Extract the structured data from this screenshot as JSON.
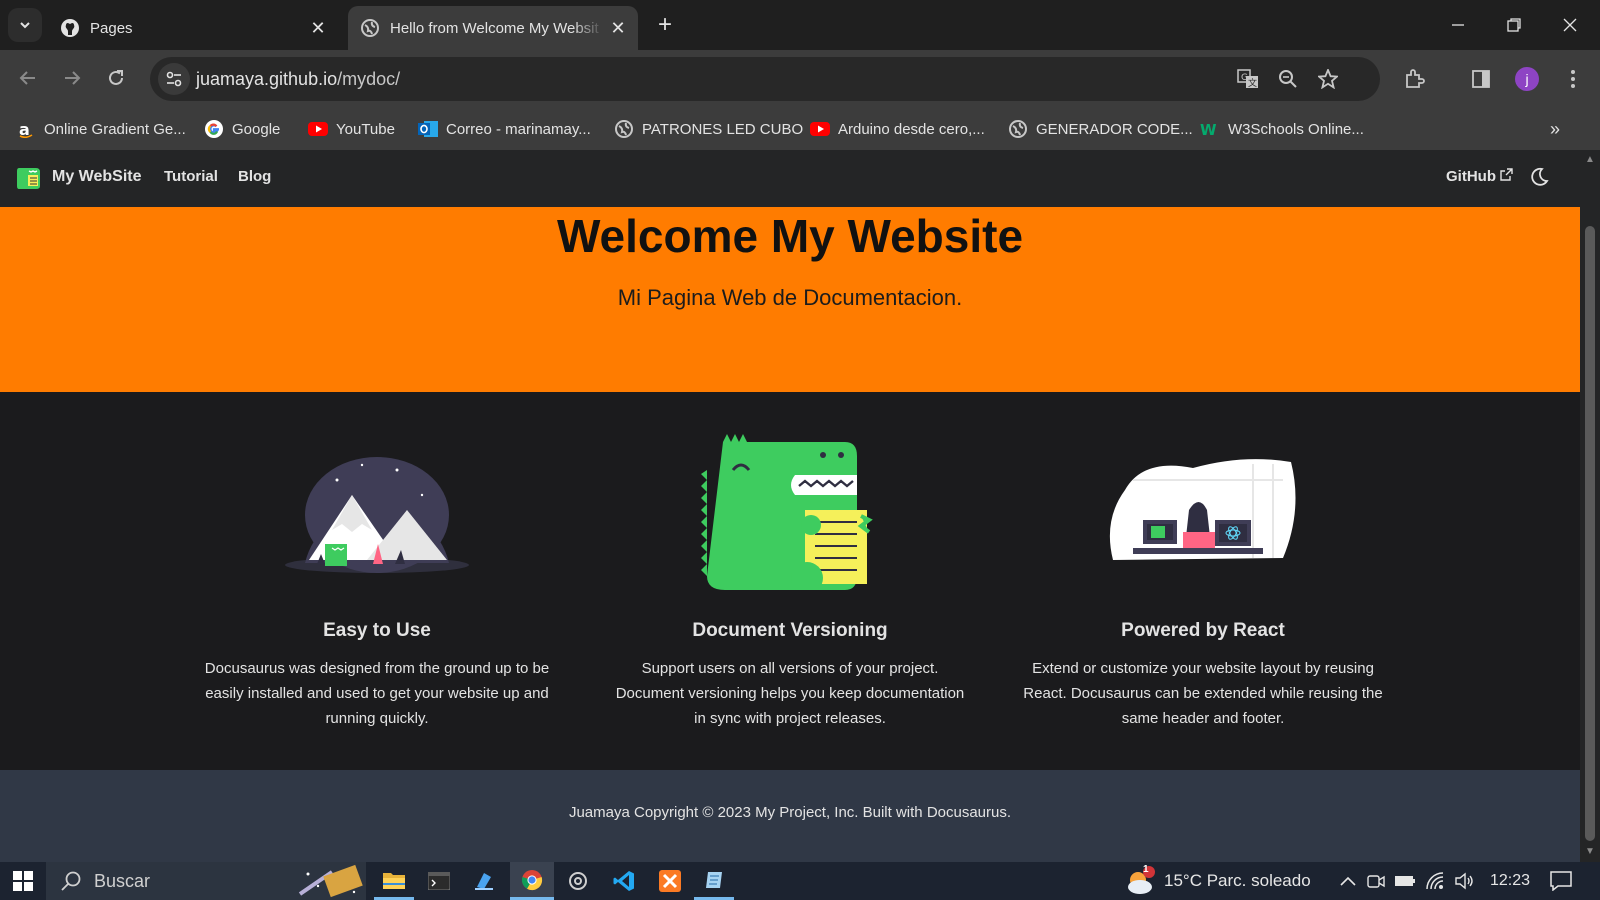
{
  "browser": {
    "tabs": [
      {
        "title": "Pages",
        "icon": "github-icon",
        "active": false
      },
      {
        "title": "Hello from Welcome My Websit",
        "icon": "globe-icon",
        "active": true
      }
    ],
    "url_host": "juamaya.github.io",
    "url_path": "/mydoc/",
    "profile_initial": "j",
    "bookmarks": [
      {
        "label": "Online Gradient Ge...",
        "icon": "a-logo-icon"
      },
      {
        "label": "Google",
        "icon": "google-icon"
      },
      {
        "label": "YouTube",
        "icon": "youtube-icon"
      },
      {
        "label": "Correo - marinamay...",
        "icon": "outlook-icon"
      },
      {
        "label": "PATRONES LED CUBO",
        "icon": "globe-icon"
      },
      {
        "label": "Arduino desde cero,...",
        "icon": "youtube-icon"
      },
      {
        "label": "GENERADOR CODE...",
        "icon": "globe-icon"
      },
      {
        "label": "W3Schools Online...",
        "icon": "w3schools-icon"
      }
    ]
  },
  "site": {
    "brand": "My WebSite",
    "nav": [
      "Tutorial",
      "Blog"
    ],
    "github": "GitHub",
    "hero_title": "Welcome My Website",
    "hero_subtitle": "Mi Pagina Web de Documentacion.",
    "features": [
      {
        "title": "Easy to Use",
        "text": "Docusaurus was designed from the ground up to be easily installed and used to get your website up and running quickly."
      },
      {
        "title": "Document Versioning",
        "text": "Support users on all versions of your project. Document versioning helps you keep documentation in sync with project releases."
      },
      {
        "title": "Powered by React",
        "text": "Extend or customize your website layout by reusing React. Docusaurus can be extended while reusing the same header and footer."
      }
    ],
    "footer": "Juamaya Copyright © 2023 My Project, Inc. Built with Docusaurus.",
    "colors": {
      "primary": "#ff7c00",
      "dino_green": "#3ecc5f"
    }
  },
  "taskbar": {
    "search_placeholder": "Buscar",
    "weather": "15°C  Parc. soleado",
    "weather_badge": "1",
    "time": "12:23"
  }
}
